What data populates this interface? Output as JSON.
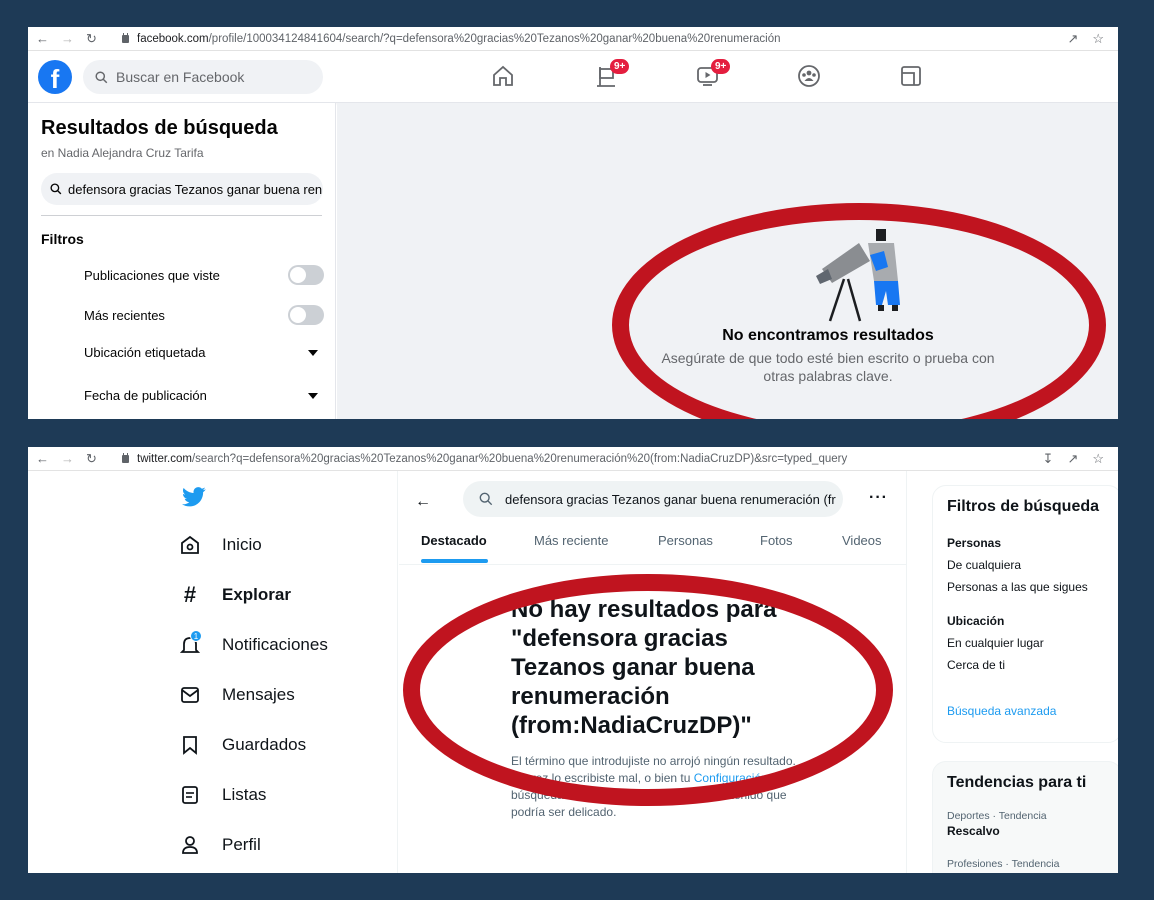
{
  "facebook": {
    "browser": {
      "url_domain": "facebook.com",
      "url_path": "/profile/100034124841604/search/?q=defensora%20gracias%20Tezanos%20ganar%20buena%20renumeración"
    },
    "search_placeholder": "Buscar en Facebook",
    "nav": {
      "groups_badge": "9+",
      "watch_badge": "9+"
    },
    "sidebar": {
      "title": "Resultados de búsqueda",
      "subtitle": "en Nadia Alejandra Cruz Tarifa",
      "query": "defensora gracias Tezanos ganar buena ren",
      "filters_label": "Filtros",
      "filters": [
        {
          "label": "Publicaciones que viste",
          "type": "toggle"
        },
        {
          "label": "Más recientes",
          "type": "toggle"
        },
        {
          "label": "Ubicación etiquetada",
          "type": "dropdown"
        },
        {
          "label": "Fecha de publicación",
          "type": "dropdown"
        }
      ]
    },
    "empty": {
      "title": "No encontramos resultados",
      "description": "Asegúrate de que todo esté bien escrito o prueba con otras palabras clave."
    }
  },
  "twitter": {
    "browser": {
      "url_domain": "twitter.com",
      "url_path": "/search?q=defensora%20gracias%20Tezanos%20ganar%20buena%20renumeración%20(from:NadiaCruzDP)&src=typed_query"
    },
    "nav": [
      {
        "label": "Inicio",
        "icon": "home-icon"
      },
      {
        "label": "Explorar",
        "icon": "hashtag-icon"
      },
      {
        "label": "Notificaciones",
        "icon": "bell-icon"
      },
      {
        "label": "Mensajes",
        "icon": "mail-icon"
      },
      {
        "label": "Guardados",
        "icon": "bookmark-icon"
      },
      {
        "label": "Listas",
        "icon": "list-icon"
      },
      {
        "label": "Perfil",
        "icon": "profile-icon"
      }
    ],
    "notif_badge": "1",
    "search_value": "defensora gracias Tezanos ganar buena renumeración (fr",
    "tabs": [
      "Destacado",
      "Más reciente",
      "Personas",
      "Fotos",
      "Videos"
    ],
    "no_results_title": "No hay resultados para \"defensora gracias Tezanos ganar buena renumeración (from:NadiaCruzDP)\"",
    "no_results_text_1": "El término que introdujiste no arrojó ningún resultado. Tal vez lo escribiste mal, o bien tu",
    "no_results_link": "Configuración",
    "no_results_text_2": "de búsqueda te está ocultando de algún contenido que podría ser delicado.",
    "filters": {
      "title": "Filtros de búsqueda",
      "people_label": "Personas",
      "people_opt_1": "De cualquiera",
      "people_opt_2": "Personas a las que sigues",
      "location_label": "Ubicación",
      "location_opt_1": "En cualquier lugar",
      "location_opt_2": "Cerca de ti",
      "advanced": "Búsqueda avanzada"
    },
    "trends": {
      "title": "Tendencias para ti",
      "items": [
        {
          "meta": "Deportes · Tendencia",
          "name": "Rescalvo"
        },
        {
          "meta": "Profesiones · Tendencia",
          "name": ""
        }
      ]
    }
  },
  "colors": {
    "background": "#1e3a56",
    "annotation_ring": "#c0141f",
    "facebook_blue": "#1877f2",
    "twitter_blue": "#1d9bf0"
  }
}
